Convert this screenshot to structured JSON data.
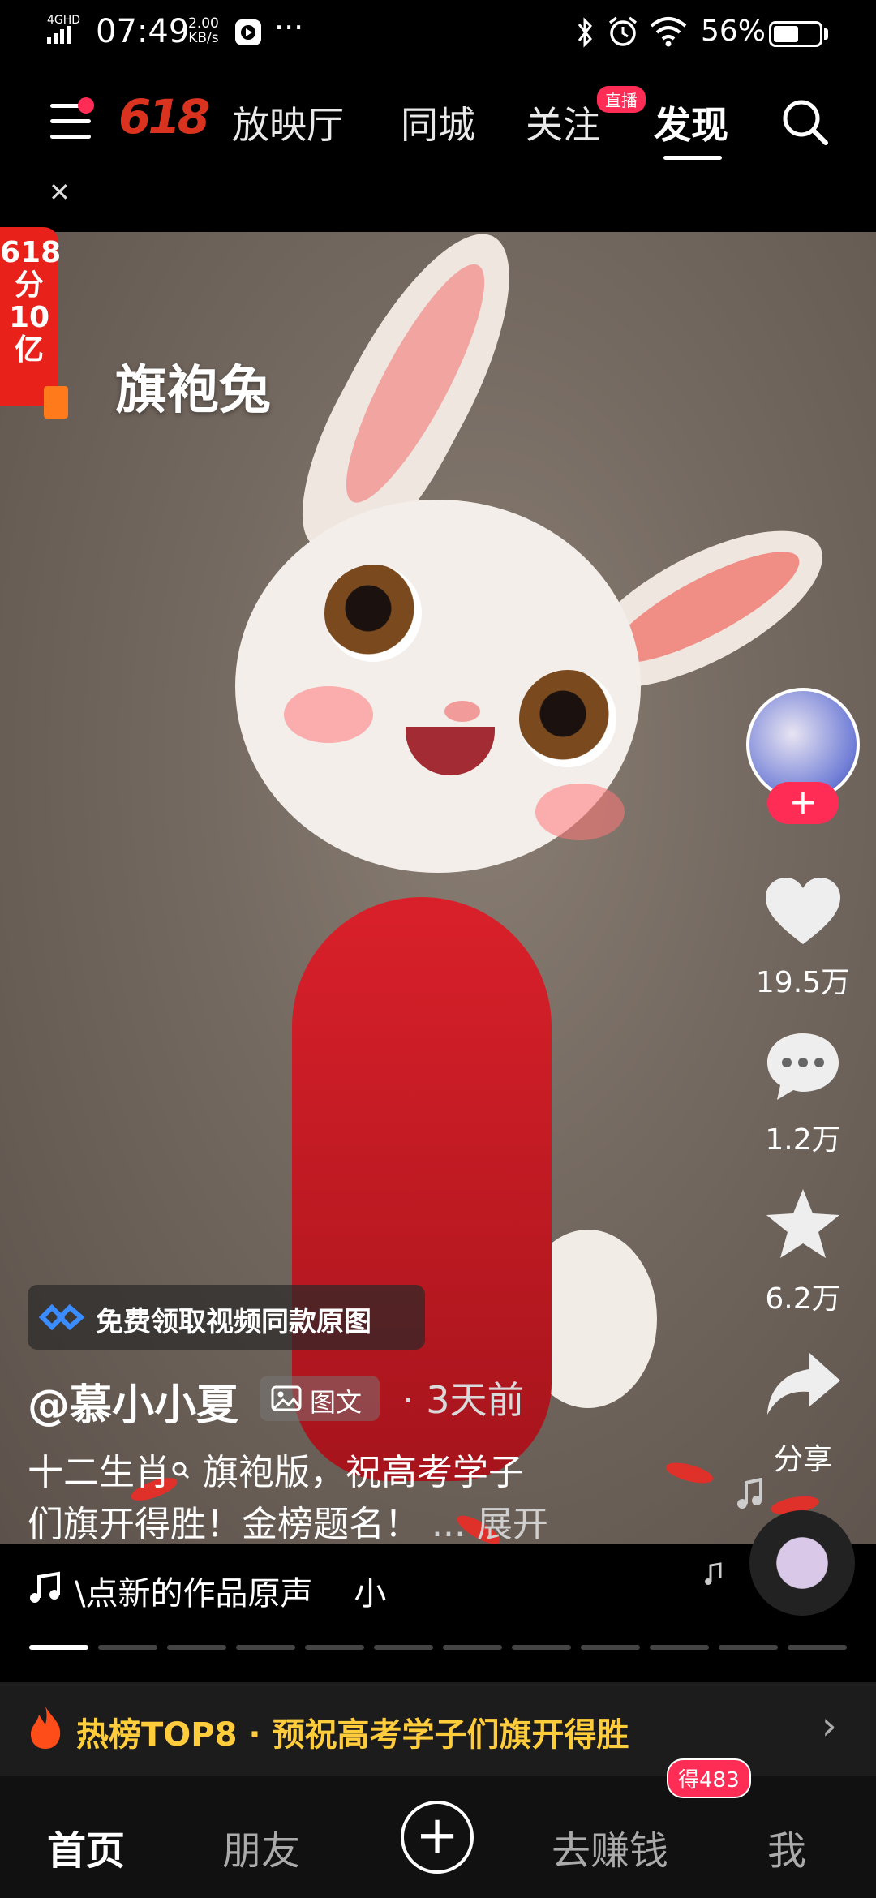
{
  "status_bar": {
    "time": "07:49",
    "network": "4GHD",
    "speed_value": "2.00",
    "speed_unit": "KB/s",
    "more": "···",
    "battery": "56%",
    "battery_level": 0.56
  },
  "top_nav": {
    "logo": "618",
    "tabs": [
      {
        "label": "放映厅"
      },
      {
        "label": "同城"
      },
      {
        "label": "关注",
        "badge": "直播"
      },
      {
        "label": "发现",
        "active": true
      }
    ]
  },
  "post": {
    "title": "旗袍兔",
    "promo": "618分10亿",
    "promo_lines": [
      "618",
      "分",
      "10",
      "亿"
    ],
    "chip_label": "免费领取视频同款原图",
    "author": "@慕小小夏",
    "type_label": "图文",
    "time_ago": "· 3天前",
    "desc_line1": "十二生肖",
    "desc_line1b": " 旗袍版，祝高考学子",
    "desc_line2": "们旗开得胜！金榜题名！",
    "expand": " ... 展开"
  },
  "rail": {
    "follow": "+",
    "like_count": "19.5万",
    "comment_count": "1.2万",
    "favorite_count": "6.2万",
    "share_label": "分享"
  },
  "music": {
    "text": "\\点新的作品原声    小"
  },
  "progress": {
    "segments": 12,
    "current": 1
  },
  "hot_banner": {
    "text": "热榜TOP8 · 预祝高考学子们旗开得胜"
  },
  "tab_bar": {
    "home": "首页",
    "friends": "朋友",
    "earn": "去赚钱",
    "earn_badge": "得483",
    "me": "我"
  },
  "colors": {
    "accent": "#ff2c55",
    "hot_text": "#ffcd3c",
    "promo_red": "#e8221b"
  }
}
